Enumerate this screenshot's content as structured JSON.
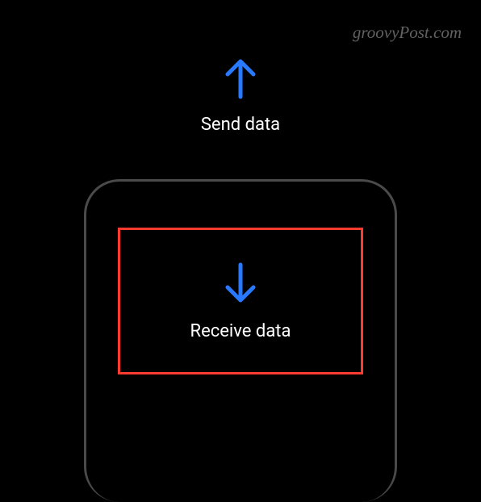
{
  "watermark": "groovyPost.com",
  "send": {
    "label": "Send data"
  },
  "receive": {
    "label": "Receive data"
  },
  "colors": {
    "accent": "#2979ff",
    "highlight": "#ff3b30"
  }
}
